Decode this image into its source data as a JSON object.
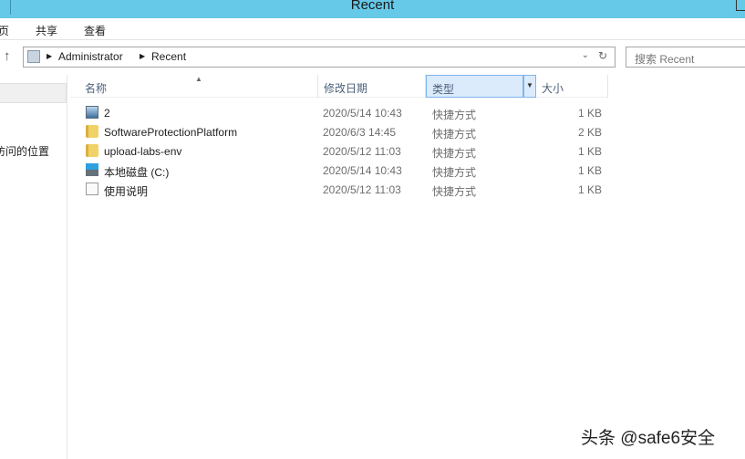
{
  "window": {
    "title": "Recent"
  },
  "ribbon": {
    "tabs": [
      "页",
      "共享",
      "查看"
    ]
  },
  "address": {
    "crumbs": [
      "Administrator",
      "Recent"
    ]
  },
  "search": {
    "placeholder": "搜索 Recent"
  },
  "nav": {
    "item": "访问的位置"
  },
  "columns": {
    "name": "名称",
    "date": "修改日期",
    "type": "类型",
    "size": "大小"
  },
  "files": [
    {
      "name": "2",
      "date": "2020/5/14 10:43",
      "type": "快捷方式",
      "size": "1 KB",
      "icon": "image"
    },
    {
      "name": "SoftwareProtectionPlatform",
      "date": "2020/6/3 14:45",
      "type": "快捷方式",
      "size": "2 KB",
      "icon": "folder"
    },
    {
      "name": "upload-labs-env",
      "date": "2020/5/12 11:03",
      "type": "快捷方式",
      "size": "1 KB",
      "icon": "folder"
    },
    {
      "name": "本地磁盘 (C:)",
      "date": "2020/5/14 10:43",
      "type": "快捷方式",
      "size": "1 KB",
      "icon": "drive"
    },
    {
      "name": "使用说明",
      "date": "2020/5/12 11:03",
      "type": "快捷方式",
      "size": "1 KB",
      "icon": "document"
    }
  ],
  "watermark": "头条 @safe6安全"
}
